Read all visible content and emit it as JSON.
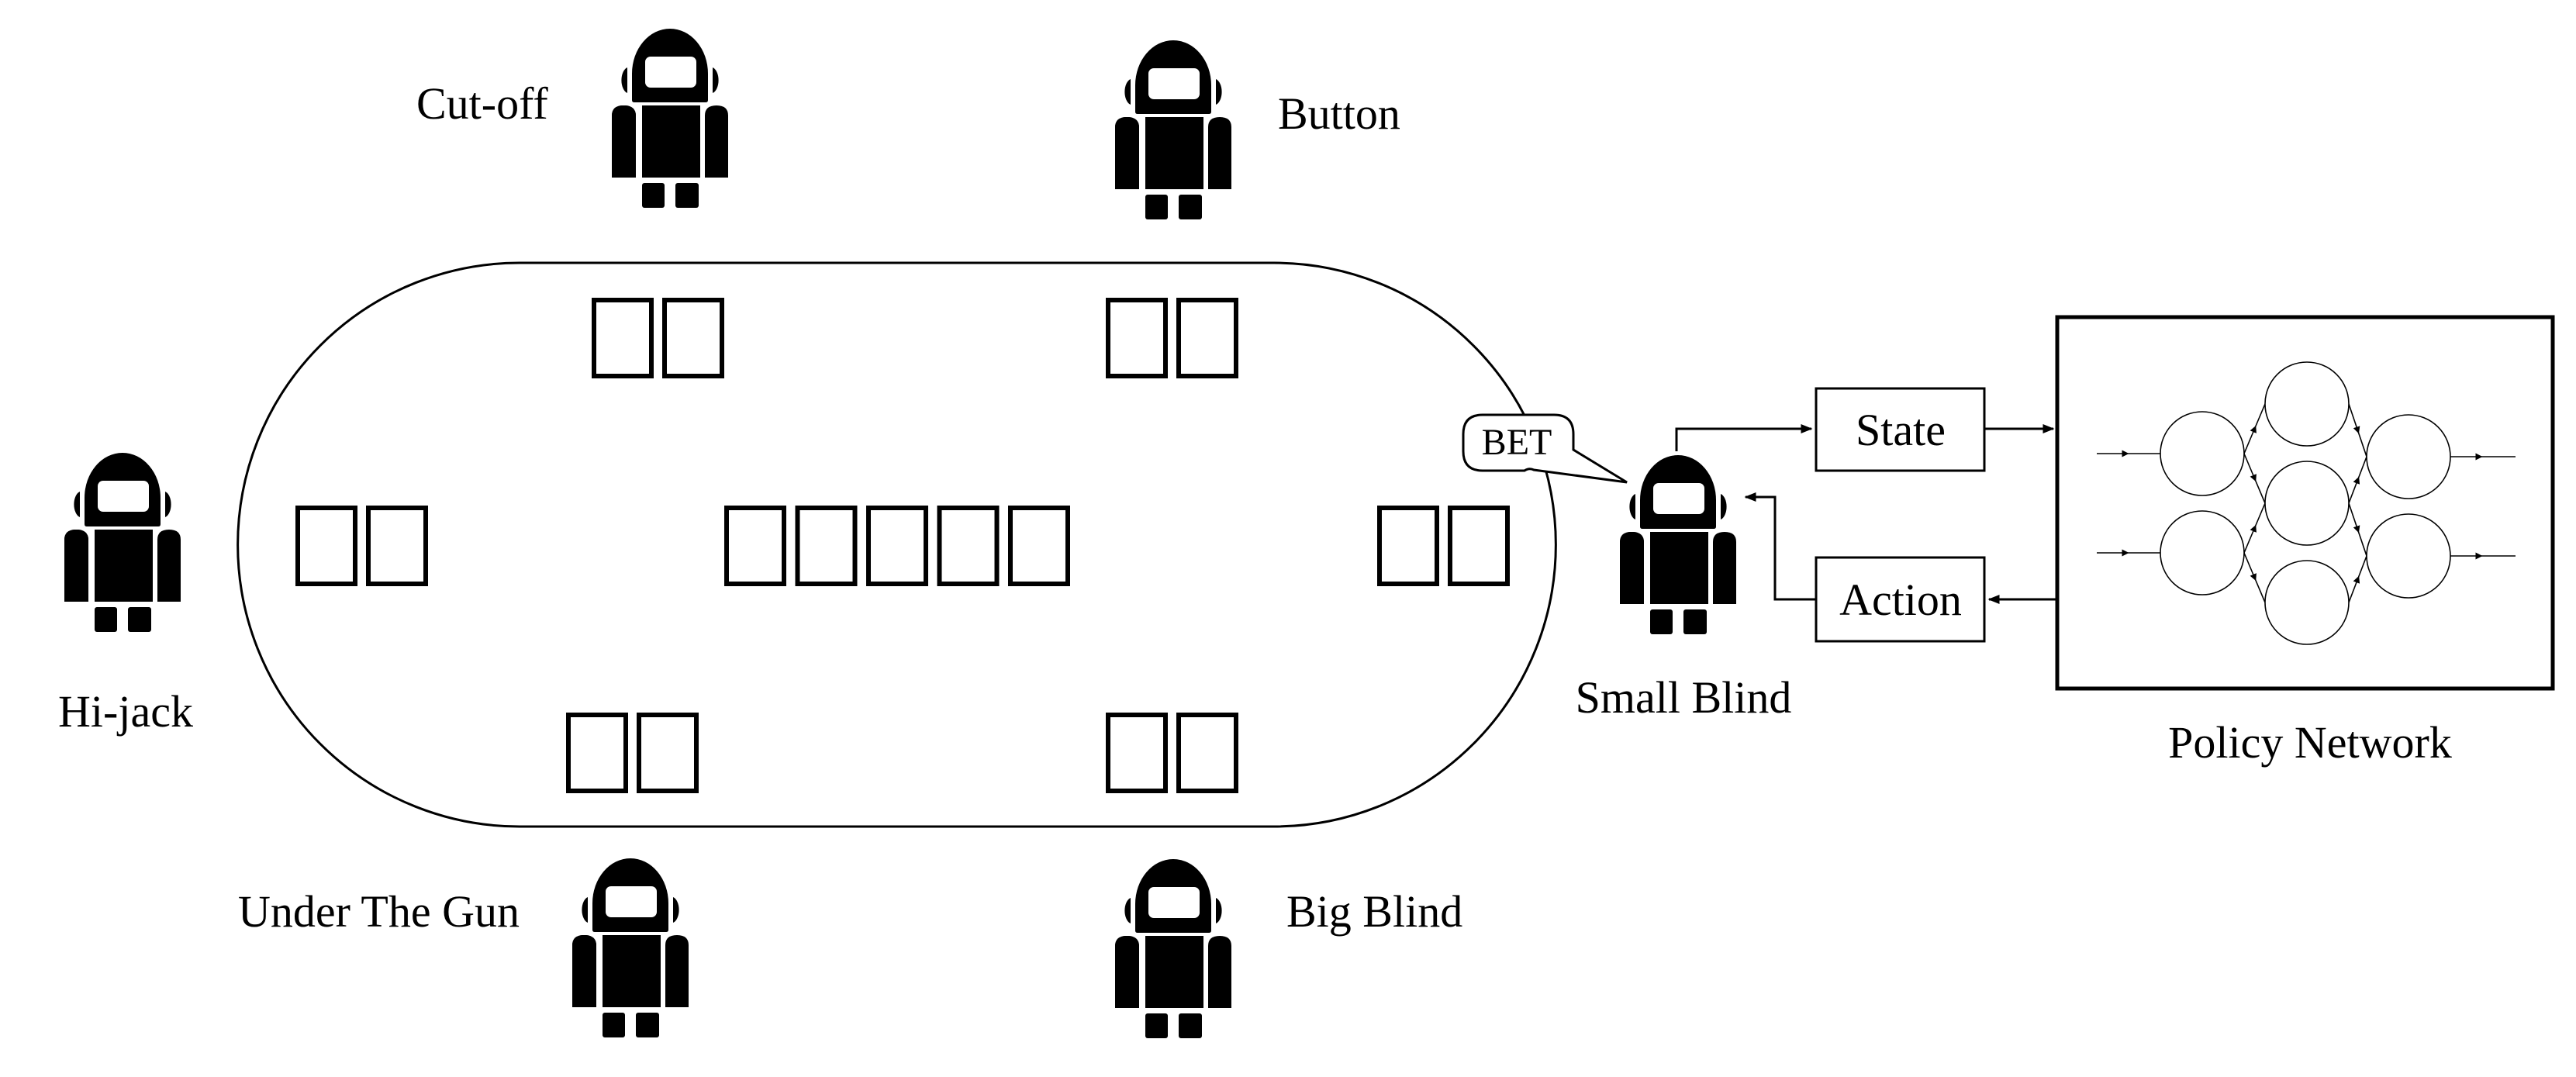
{
  "figure": {
    "colors": {
      "ink": "#000000",
      "background": "#ffffff"
    },
    "table": {
      "community_cards": 5,
      "hole_cards_per_player": 2
    },
    "players": [
      {
        "id": "cut-off",
        "label": "Cut-off",
        "icon": "robot-icon"
      },
      {
        "id": "button",
        "label": "Button",
        "icon": "robot-icon"
      },
      {
        "id": "hi-jack",
        "label": "Hi-jack",
        "icon": "robot-icon"
      },
      {
        "id": "small-blind",
        "label": "Small Blind",
        "icon": "robot-icon"
      },
      {
        "id": "under-the-gun",
        "label": "Under The Gun",
        "icon": "robot-icon"
      },
      {
        "id": "big-blind",
        "label": "Big Blind",
        "icon": "robot-icon"
      }
    ],
    "speech_bubble": {
      "text": "BET",
      "speaker": "small-blind"
    },
    "flow": {
      "state_label": "State",
      "action_label": "Action"
    },
    "policy_network": {
      "label": "Policy Network",
      "layers": [
        2,
        3,
        2
      ],
      "inputs": 2,
      "outputs": 2
    }
  }
}
